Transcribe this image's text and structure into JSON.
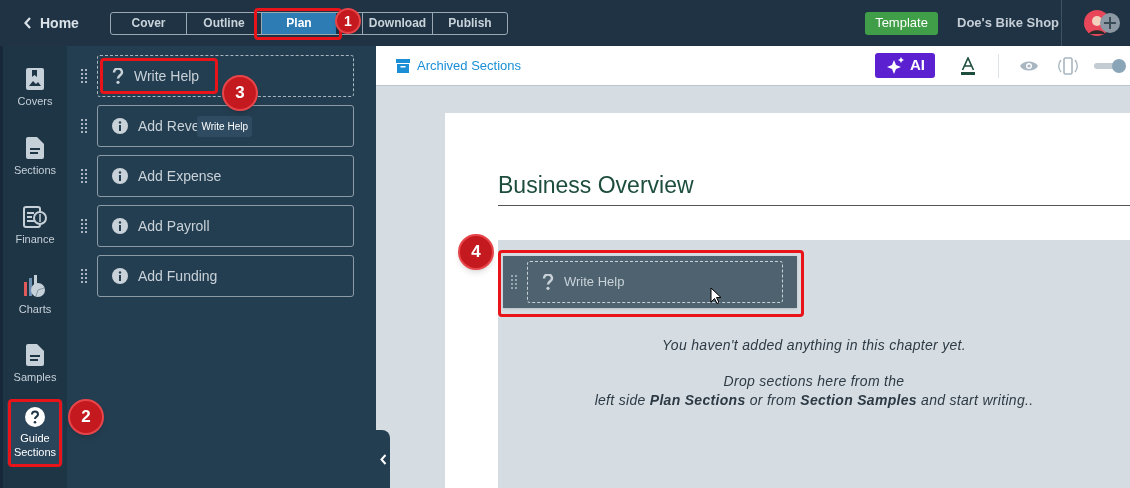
{
  "header": {
    "back": "Home",
    "tabs": [
      {
        "label": "Cover",
        "selected": false
      },
      {
        "label": "Outline",
        "selected": false
      },
      {
        "label": "Plan",
        "selected": true
      },
      {
        "label": "Download",
        "selected": false
      },
      {
        "label": "Publish",
        "selected": false
      }
    ],
    "template_button": "Template",
    "business_name": "Doe's Bike Shop"
  },
  "rail": {
    "items": [
      {
        "label": "Covers",
        "selected": false
      },
      {
        "label": "Sections",
        "selected": false
      },
      {
        "label": "Finance",
        "selected": false
      },
      {
        "label": "Charts",
        "selected": false
      },
      {
        "label": "Samples",
        "selected": false
      },
      {
        "label": "Guide Sections",
        "selected": true
      }
    ]
  },
  "panel": {
    "items": [
      {
        "kind": "help",
        "label": "Write Help"
      },
      {
        "kind": "info",
        "label": "Add Reve"
      },
      {
        "kind": "info",
        "label": "Add Expense"
      },
      {
        "kind": "info",
        "label": "Add Payroll"
      },
      {
        "kind": "info",
        "label": "Add Funding"
      }
    ],
    "tooltip": "Write Help"
  },
  "toolbar": {
    "archived": "Archived Sections",
    "ai_button": "AI",
    "preview_toggle": {
      "on": true
    }
  },
  "document": {
    "heading": "Business Overview",
    "dragged_item": "Write Help",
    "empty_message": "You haven't added anything in this chapter yet.",
    "hint_lines": [
      "Drop sections here from the",
      "left side **Plan Sections** or from **Section Samples** and start writing.."
    ]
  },
  "annotations": [
    {
      "label": "1"
    },
    {
      "label": "2"
    },
    {
      "label": "3"
    },
    {
      "label": "4"
    }
  ]
}
